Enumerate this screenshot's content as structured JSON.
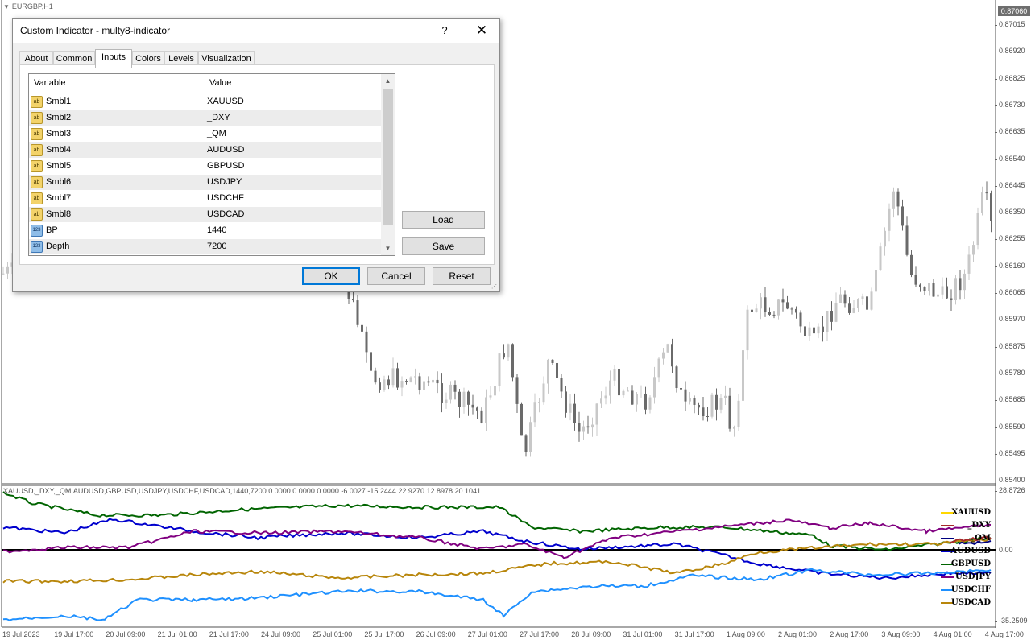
{
  "chart": {
    "title": "EURGBP,H1",
    "current_price": "0.87060",
    "price_ticks": [
      "0.87015",
      "0.86920",
      "0.86825",
      "0.86730",
      "0.86635",
      "0.86540",
      "0.86445",
      "0.86350",
      "0.86255",
      "0.86160",
      "0.86065",
      "0.85970",
      "0.85875",
      "0.85780",
      "0.85685",
      "0.85590",
      "0.85495",
      "0.85400"
    ],
    "subwindow_label": "XAUUSD,_DXY,_QM,AUDUSD,GBPUSD,USDJPY,USDCHF,USDCAD,1440,7200 0.0000 0.0000 0.0000 -6.0027 -15.2444 22.9270 12.8978 20.1041",
    "sub_ticks": [
      "28.8726",
      "0.00",
      "-35.2509"
    ],
    "time_labels": [
      "19 Jul 2023",
      "19 Jul 17:00",
      "20 Jul 09:00",
      "21 Jul 01:00",
      "21 Jul 17:00",
      "24 Jul 09:00",
      "25 Jul 01:00",
      "25 Jul 17:00",
      "26 Jul 09:00",
      "27 Jul 01:00",
      "27 Jul 17:00",
      "28 Jul 09:00",
      "31 Jul 01:00",
      "31 Jul 17:00",
      "1 Aug 09:00",
      "2 Aug 01:00",
      "2 Aug 17:00",
      "3 Aug 09:00",
      "4 Aug 01:00",
      "4 Aug 17:00"
    ],
    "legend": [
      {
        "name": "XAUUSD",
        "color": "#ffd700"
      },
      {
        "name": "_DXY",
        "color": "#a52a2a"
      },
      {
        "name": "_QM",
        "color": "#000080"
      },
      {
        "name": "AUDUSD",
        "color": "#0000cd"
      },
      {
        "name": "GBPUSD",
        "color": "#006400"
      },
      {
        "name": "USDJPY",
        "color": "#800080"
      },
      {
        "name": "USDCHF",
        "color": "#1e90ff"
      },
      {
        "name": "USDCAD",
        "color": "#b8860b"
      }
    ]
  },
  "dialog": {
    "title": "Custom Indicator - multy8-indicator",
    "help": "?",
    "close": "✕",
    "tabs": [
      "About",
      "Common",
      "Inputs",
      "Colors",
      "Levels",
      "Visualization"
    ],
    "active_tab": "Inputs",
    "columns": {
      "variable": "Variable",
      "value": "Value"
    },
    "rows": [
      {
        "type": "ab",
        "name": "Smbl1",
        "value": "XAUUSD"
      },
      {
        "type": "ab",
        "name": "Smbl2",
        "value": "_DXY"
      },
      {
        "type": "ab",
        "name": "Smbl3",
        "value": "_QM"
      },
      {
        "type": "ab",
        "name": "Smbl4",
        "value": "AUDUSD"
      },
      {
        "type": "ab",
        "name": "Smbl5",
        "value": "GBPUSD"
      },
      {
        "type": "ab",
        "name": "Smbl6",
        "value": "USDJPY"
      },
      {
        "type": "ab",
        "name": "Smbl7",
        "value": "USDCHF"
      },
      {
        "type": "ab",
        "name": "Smbl8",
        "value": "USDCAD"
      },
      {
        "type": "123",
        "name": "BP",
        "value": "1440"
      },
      {
        "type": "123",
        "name": "Depth",
        "value": "7200"
      }
    ],
    "buttons": {
      "load": "Load",
      "save": "Save",
      "ok": "OK",
      "cancel": "Cancel",
      "reset": "Reset"
    }
  }
}
